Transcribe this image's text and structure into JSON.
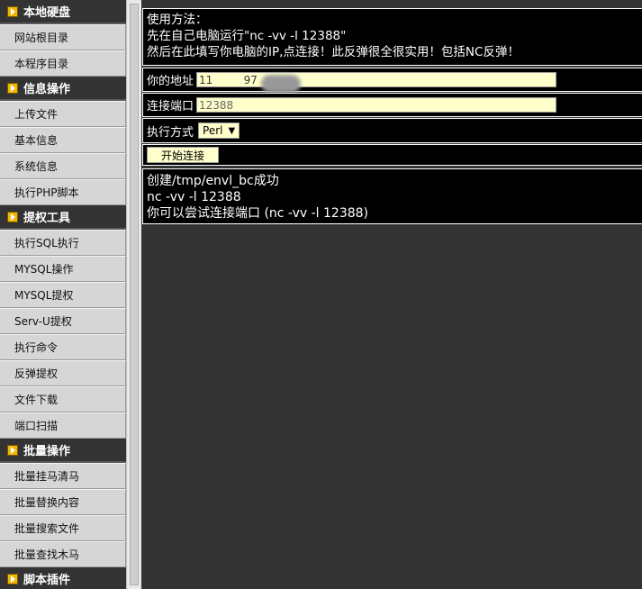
{
  "sidebar": {
    "sections": [
      {
        "header": "本地硬盘",
        "items": [
          "网站根目录",
          "本程序目录"
        ]
      },
      {
        "header": "信息操作",
        "items": [
          "上传文件",
          "基本信息",
          "系统信息",
          "执行PHP脚本"
        ]
      },
      {
        "header": "提权工具",
        "items": [
          "执行SQL执行",
          "MYSQL操作",
          "MYSQL提权",
          "Serv-U提权",
          "执行命令",
          "反弹提权",
          "文件下载",
          "端口扫描"
        ]
      },
      {
        "header": "批量操作",
        "items": [
          "批量挂马清马",
          "批量替换内容",
          "批量搜索文件",
          "批量查找木马"
        ]
      },
      {
        "header": "脚本插件",
        "items": []
      }
    ]
  },
  "usage": {
    "line1": "使用方法：",
    "line2": "先在自己电脑运行\"nc -vv -l 12388\"",
    "line3": "然后在此填写你电脑的IP,点连接！此反弹很全很实用！包括NC反弹！"
  },
  "form": {
    "address_label": "你的地址",
    "address_value": "11         97",
    "port_label": "连接端口",
    "port_value": "12388",
    "method_label": "执行方式",
    "method_selected": "Perl",
    "start_button": "开始连接"
  },
  "result": {
    "line1": "创建/tmp/envl_bc成功",
    "line2": "nc -vv -l 12388",
    "line3": "你可以尝试连接端口 (nc -vv -l 12388)"
  },
  "colors": {
    "sidebar_header_bg": "#333333",
    "sidebar_item_bg": "#d6d6d6",
    "main_bg": "#333333",
    "panel_bg": "#000000",
    "input_bg": "#ffffcc",
    "section_icon": "#f2b705"
  },
  "icons": {
    "section_icon": "arrow-right-icon",
    "select_arrow": "caret-down-icon"
  }
}
